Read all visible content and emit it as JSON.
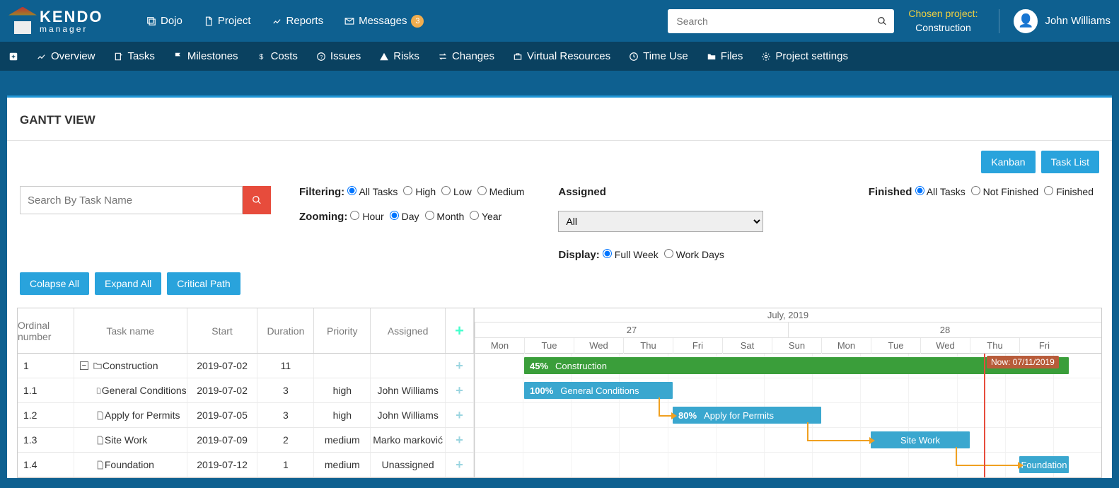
{
  "header": {
    "logo": {
      "t1": "KENDO",
      "t2": "manager"
    },
    "nav": [
      {
        "icon": "dojo",
        "label": "Dojo"
      },
      {
        "icon": "project",
        "label": "Project"
      },
      {
        "icon": "reports",
        "label": "Reports"
      },
      {
        "icon": "messages",
        "label": "Messages",
        "badge": "3"
      }
    ],
    "search_placeholder": "Search",
    "chosen_label": "Chosen project:",
    "chosen_value": "Construction",
    "user": "John Williams"
  },
  "subnav": [
    {
      "icon": "plus",
      "label": ""
    },
    {
      "icon": "chart",
      "label": "Overview"
    },
    {
      "icon": "tasks",
      "label": "Tasks"
    },
    {
      "icon": "flag",
      "label": "Milestones"
    },
    {
      "icon": "dollar",
      "label": "Costs"
    },
    {
      "icon": "q",
      "label": "Issues"
    },
    {
      "icon": "warn",
      "label": "Risks"
    },
    {
      "icon": "swap",
      "label": "Changes"
    },
    {
      "icon": "case",
      "label": "Virtual Resources"
    },
    {
      "icon": "clock",
      "label": "Time Use"
    },
    {
      "icon": "folder",
      "label": "Files"
    },
    {
      "icon": "gear",
      "label": "Project settings"
    }
  ],
  "page": {
    "title": "GANTT VIEW",
    "view_buttons": {
      "kanban": "Kanban",
      "tasklist": "Task List"
    },
    "search_placeholder": "Search By Task Name",
    "btns": {
      "collapse": "Colapse All",
      "expand": "Expand All",
      "critical": "Critical Path"
    },
    "filtering": {
      "label": "Filtering:",
      "opts": [
        "All Tasks",
        "High",
        "Low",
        "Medium"
      ],
      "sel": 0
    },
    "zooming": {
      "label": "Zooming:",
      "opts": [
        "Hour",
        "Day",
        "Month",
        "Year"
      ],
      "sel": 1
    },
    "assigned": {
      "label": "Assigned",
      "value": "All"
    },
    "display": {
      "label": "Display:",
      "opts": [
        "Full Week",
        "Work Days"
      ],
      "sel": 0
    },
    "finished": {
      "label": "Finished",
      "opts": [
        "All Tasks",
        "Not Finished",
        "Finished"
      ],
      "sel": 0
    }
  },
  "grid": {
    "headers": [
      "Ordinal number",
      "Task name",
      "Start",
      "Duration",
      "Priority",
      "Assigned"
    ],
    "rows": [
      {
        "ord": "1",
        "name": "Construction",
        "start": "2019-07-02",
        "dur": "11",
        "pri": "",
        "asn": "",
        "parent": true
      },
      {
        "ord": "1.1",
        "name": "General Conditions",
        "start": "2019-07-02",
        "dur": "3",
        "pri": "high",
        "asn": "John Williams"
      },
      {
        "ord": "1.2",
        "name": "Apply for Permits",
        "start": "2019-07-05",
        "dur": "3",
        "pri": "high",
        "asn": "John Williams"
      },
      {
        "ord": "1.3",
        "name": "Site Work",
        "start": "2019-07-09",
        "dur": "2",
        "pri": "medium",
        "asn": "Marko marković"
      },
      {
        "ord": "1.4",
        "name": "Foundation",
        "start": "2019-07-12",
        "dur": "1",
        "pri": "medium",
        "asn": "Unassigned"
      }
    ]
  },
  "gantt": {
    "month": "July, 2019",
    "weeks": [
      "27",
      "28"
    ],
    "days": [
      "Mon",
      "Tue",
      "Wed",
      "Thu",
      "Fri",
      "Sat",
      "Sun",
      "Mon",
      "Tue",
      "Wed",
      "Thu",
      "Fri"
    ],
    "now_label": "Now: 07/11/2019",
    "now_col": 10,
    "bars": [
      {
        "row": 0,
        "start": 1,
        "span": 11,
        "pct": "45%",
        "label": "Construction",
        "parent": true
      },
      {
        "row": 1,
        "start": 1,
        "span": 3,
        "pct": "100%",
        "label": "General Conditions"
      },
      {
        "row": 2,
        "start": 4,
        "span": 3,
        "pct": "80%",
        "label": "Apply for Permits"
      },
      {
        "row": 3,
        "start": 8,
        "span": 2,
        "pct": "",
        "label": "Site Work",
        "center": true
      },
      {
        "row": 4,
        "start": 11,
        "span": 1,
        "pct": "",
        "label": "Foundation",
        "center": true
      }
    ]
  }
}
